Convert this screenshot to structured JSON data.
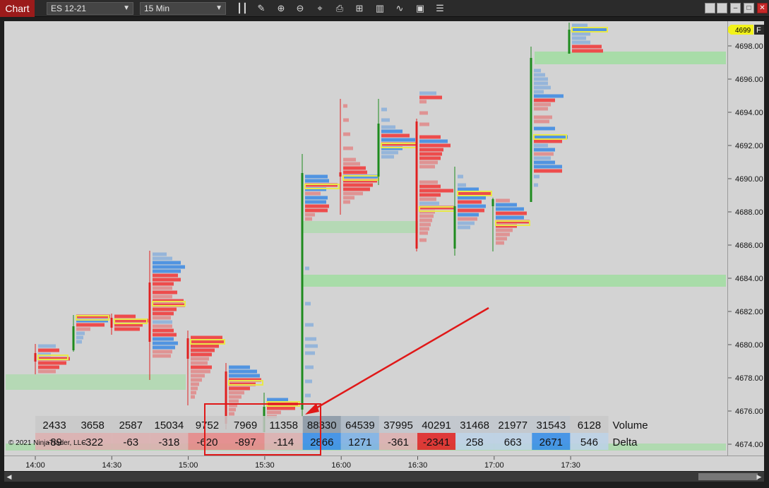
{
  "toolbar": {
    "tab_label": "Chart",
    "instrument": "ES 12-21",
    "interval": "15 Min",
    "icons": [
      "bar-type-icon",
      "draw-pen-icon",
      "zoom-in-icon",
      "zoom-out-icon",
      "crosshair-icon",
      "data-box-icon",
      "properties-icon",
      "strategy-icon",
      "indicator-icon",
      "template-icon",
      "list-icon"
    ],
    "window_buttons": [
      "restore-icon",
      "restore-icon",
      "minimize-icon",
      "maximize-icon",
      "close-icon"
    ]
  },
  "price_axis": {
    "current_price": "4699",
    "flag_label": "F",
    "labels": [
      "4698.00",
      "4696.00",
      "4694.00",
      "4692.00",
      "4690.00",
      "4688.00",
      "4686.00",
      "4684.00",
      "4682.00",
      "4680.00",
      "4678.00",
      "4676.00",
      "4674.00"
    ]
  },
  "time_axis": {
    "labels": [
      "14:00",
      "14:30",
      "15:00",
      "15:30",
      "16:00",
      "16:30",
      "17:00",
      "17:30"
    ]
  },
  "summary": {
    "volume_label": "Volume",
    "delta_label": "Delta",
    "volume": [
      "2433",
      "3658",
      "2587",
      "15034",
      "9752",
      "7969",
      "11358",
      "88330",
      "64539",
      "37995",
      "40291",
      "31468",
      "21977",
      "31543",
      "6128"
    ],
    "delta": [
      "-89",
      "-322",
      "-63",
      "-318",
      "-620",
      "-897",
      "-114",
      "2866",
      "1271",
      "-361",
      "-2341",
      "258",
      "663",
      "2671",
      "546"
    ]
  },
  "copyright": "© 2021 NinjaTrader, LLC",
  "colors": {
    "up": "#1e8b1e",
    "down": "#e02020",
    "buy_vol": "#4a90e2",
    "sell_vol": "#ee4444",
    "poc_outline": "#e8e84a",
    "zone": "#a8dca8",
    "annotation": "#e01818",
    "background": "#d3d3d3"
  }
}
